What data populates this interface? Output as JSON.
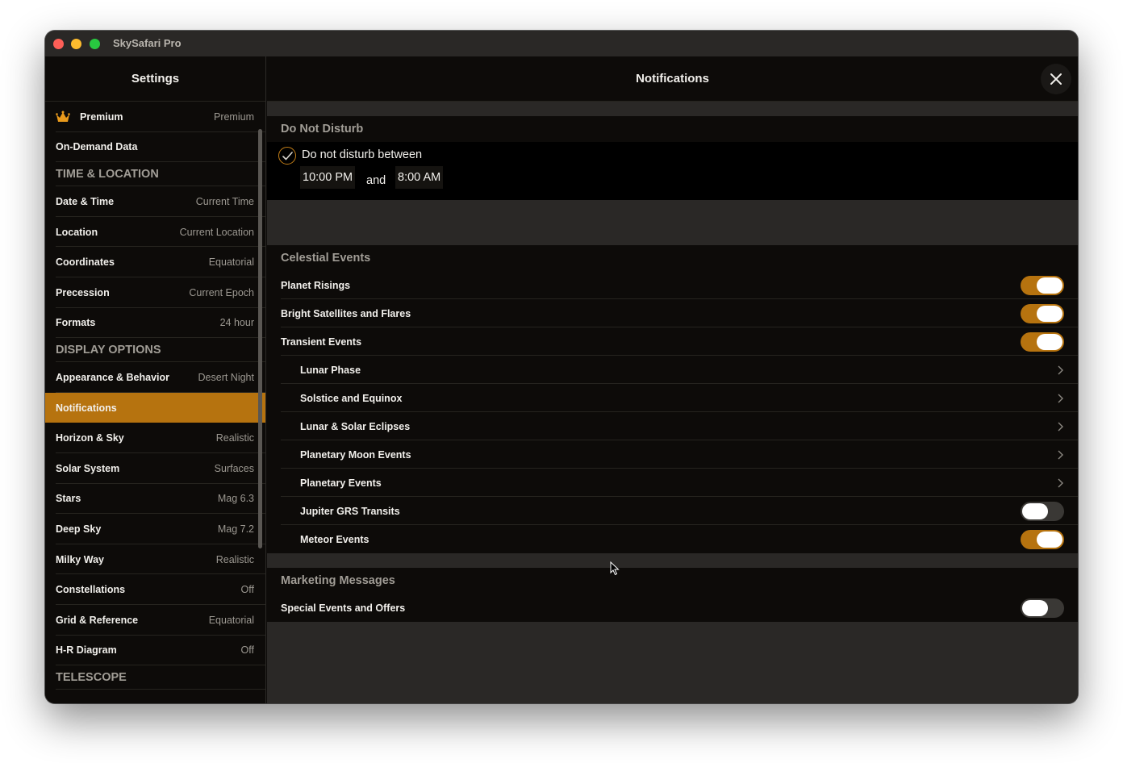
{
  "window": {
    "app_title": "SkySafari Pro"
  },
  "sidebar": {
    "title": "Settings",
    "top_items": [
      {
        "label": "Premium",
        "value": "Premium",
        "icon": "crown-icon"
      },
      {
        "label": "On-Demand Data",
        "value": ""
      }
    ],
    "sections": [
      {
        "title": "TIME & LOCATION",
        "items": [
          {
            "label": "Date & Time",
            "value": "Current Time"
          },
          {
            "label": "Location",
            "value": "Current Location"
          },
          {
            "label": "Coordinates",
            "value": "Equatorial"
          },
          {
            "label": "Precession",
            "value": "Current Epoch"
          },
          {
            "label": "Formats",
            "value": "24 hour"
          }
        ]
      },
      {
        "title": "DISPLAY OPTIONS",
        "items": [
          {
            "label": "Appearance & Behavior",
            "value": "Desert Night"
          },
          {
            "label": "Notifications",
            "value": "",
            "active": true
          },
          {
            "label": "Horizon & Sky",
            "value": "Realistic"
          },
          {
            "label": "Solar System",
            "value": "Surfaces"
          },
          {
            "label": "Stars",
            "value": "Mag 6.3"
          },
          {
            "label": "Deep Sky",
            "value": "Mag 7.2"
          },
          {
            "label": "Milky Way",
            "value": "Realistic"
          },
          {
            "label": "Constellations",
            "value": "Off"
          },
          {
            "label": "Grid & Reference",
            "value": "Equatorial"
          },
          {
            "label": "H-R Diagram",
            "value": "Off"
          }
        ]
      },
      {
        "title": "TELESCOPE",
        "items": []
      }
    ]
  },
  "main": {
    "title": "Notifications",
    "dnd": {
      "title": "Do Not Disturb",
      "checked": true,
      "label": "Do not disturb between",
      "start": "10:00 PM",
      "and": "and",
      "end": "8:00 AM"
    },
    "celestial": {
      "title": "Celestial Events",
      "rows": [
        {
          "label": "Planet Risings",
          "kind": "toggle",
          "on": true
        },
        {
          "label": "Bright Satellites and Flares",
          "kind": "toggle",
          "on": true
        },
        {
          "label": "Transient Events",
          "kind": "toggle",
          "on": true
        },
        {
          "label": "Lunar Phase",
          "kind": "link"
        },
        {
          "label": "Solstice and Equinox",
          "kind": "link"
        },
        {
          "label": "Lunar & Solar Eclipses",
          "kind": "link"
        },
        {
          "label": "Planetary Moon Events",
          "kind": "link"
        },
        {
          "label": "Planetary Events",
          "kind": "link"
        },
        {
          "label": "Jupiter GRS Transits",
          "kind": "toggle",
          "on": false
        },
        {
          "label": "Meteor Events",
          "kind": "toggle",
          "on": true
        }
      ]
    },
    "marketing": {
      "title": "Marketing Messages",
      "rows": [
        {
          "label": "Special Events and Offers",
          "kind": "toggle",
          "on": false
        }
      ]
    }
  },
  "colors": {
    "accent": "#b6730f",
    "background": "#0d0b09",
    "separator": "#2a2826"
  }
}
